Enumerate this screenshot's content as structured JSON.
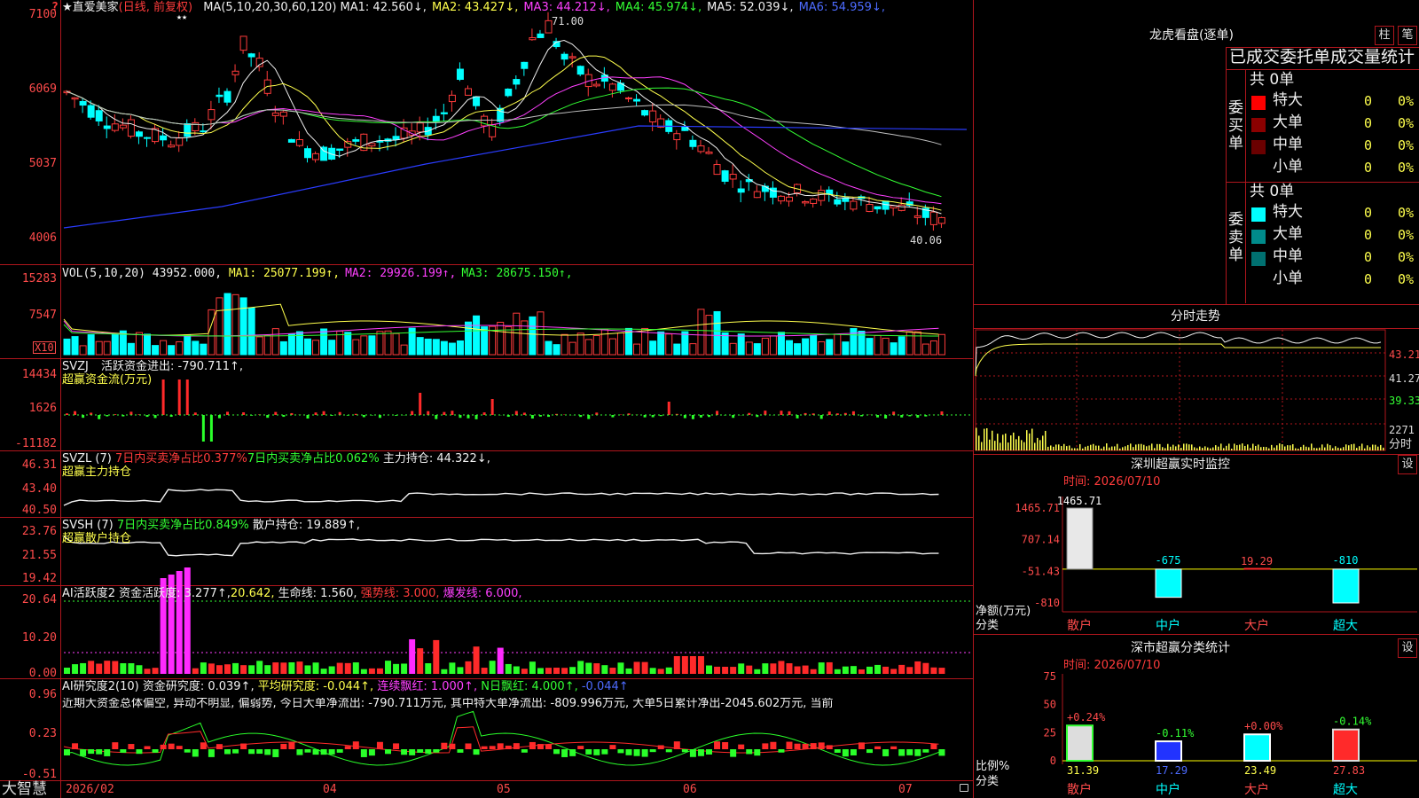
{
  "main_chart": {
    "star_name": "★直爱美家",
    "mode": "(日线, 前复权)",
    "ma_params": "MA(5,10,20,30,60,120)",
    "ma": [
      {
        "label": "MA1:",
        "value": "42.560",
        "arrow": "↓",
        "color": "#f0f0f0"
      },
      {
        "label": "MA2:",
        "value": "43.427",
        "arrow": "↓",
        "color": "#ffff4d"
      },
      {
        "label": "MA3:",
        "value": "44.212",
        "arrow": "↓",
        "color": "#ff40ff"
      },
      {
        "label": "MA4:",
        "value": "45.974",
        "arrow": "↓",
        "color": "#33ff33"
      },
      {
        "label": "MA5:",
        "value": "52.039",
        "arrow": "↓",
        "color": "#f0f0f0"
      },
      {
        "label": "MA6:",
        "value": "54.959",
        "arrow": "↓",
        "color": "#4d6bff"
      }
    ],
    "y_labels": [
      "7100",
      "6069",
      "5037",
      "4006"
    ],
    "high_marker": "71.00",
    "low_marker": "40.06",
    "badge": "?",
    "stars": "★★"
  },
  "vol": {
    "title": "VOL(5,10,20)",
    "value": "43952.000",
    "ma": [
      {
        "label": "MA1:",
        "value": "25077.199",
        "arrow": "↑",
        "color": "#ffff4d"
      },
      {
        "label": "MA2:",
        "value": "29926.199",
        "arrow": "↑",
        "color": "#ff40ff"
      },
      {
        "label": "MA3:",
        "value": "28675.150",
        "arrow": "↑",
        "color": "#33ff33"
      }
    ],
    "y_labels": [
      "15283",
      "7547"
    ],
    "unit": "X10"
  },
  "svzj": {
    "title": "SVZJ",
    "line1": "活跃资金进出: -790.711↑,",
    "line2": "超赢资金流(万元)",
    "y_labels": [
      "14434",
      "1626",
      "-11182"
    ]
  },
  "svzl": {
    "title": "SVZL (7)",
    "a": "7日内买卖净占比0.377%",
    "b": "7日内买卖净占比0.062%",
    "c": "主力持仓: 44.322↓,",
    "line2": "超赢主力持仓",
    "y_labels": [
      "46.31",
      "43.40",
      "40.50"
    ]
  },
  "svsh": {
    "title": "SVSH (7)",
    "a": "7日内买卖净占比0.849%",
    "b": "散户持仓: 19.889↑,",
    "line2": "超赢散户持仓",
    "y_labels": [
      "23.76",
      "21.55",
      "19.42"
    ]
  },
  "ai_active": {
    "title": "AI活跃度2",
    "a": "资金活跃度: 3.277↑,",
    "b": "20.642,",
    "c": "生命线: 1.560,",
    "d": "强势线: 3.000,",
    "e": "爆发线: 6.000,",
    "y_labels": [
      "20.64",
      "10.20",
      "0.00"
    ]
  },
  "ai_research": {
    "title": "AI研究度2(10)",
    "a": "资金研究度: 0.039↑,",
    "b": "平均研究度: -0.044↑,",
    "c": "连续飘红: 1.000↑,",
    "d": "N日飘红: 4.000↑,",
    "e": "-0.044↑",
    "comment": "近期大资金总体偏空, 异动不明显, 偏弱势, 今日大单净流出: -790.711万元, 其中特大单净流出: -809.996万元, 大单5日累计净出-2045.602万元, 当前",
    "y_labels": [
      "0.96",
      "0.23",
      "-0.51"
    ]
  },
  "bottom_bar": {
    "brand": "大智慧",
    "dates": [
      "2026/02",
      "04",
      "05",
      "06",
      "07"
    ]
  },
  "dragon_tiger": {
    "title": "龙虎看盘(逐单)",
    "btn_bar": "柱",
    "btn_pen": "笔",
    "subtitle": "已成交委托单成交量统计",
    "buy_label": "委买单",
    "sell_label": "委卖单",
    "buy_total": "共 0单",
    "sell_total": "共 0单",
    "buy_rows": [
      {
        "name": "特大",
        "count": "0",
        "pct": "0%",
        "color": "#ff0000"
      },
      {
        "name": "大单",
        "count": "0",
        "pct": "0%",
        "color": "#8b0000"
      },
      {
        "name": "中单",
        "count": "0",
        "pct": "0%",
        "color": "#6a0000"
      },
      {
        "name": "小单",
        "count": "0",
        "pct": "0%",
        "color": "#000000"
      }
    ],
    "sell_rows": [
      {
        "name": "特大",
        "count": "0",
        "pct": "0%",
        "color": "#00ffff"
      },
      {
        "name": "大单",
        "count": "0",
        "pct": "0%",
        "color": "#008b8b"
      },
      {
        "name": "中单",
        "count": "0",
        "pct": "0%",
        "color": "#007070"
      },
      {
        "name": "小单",
        "count": "0",
        "pct": "0%",
        "color": "#000000"
      }
    ]
  },
  "intraday": {
    "title": "分时走势",
    "y_labels": [
      "43.21",
      "41.27",
      "39.33"
    ],
    "vol_label": "2271",
    "vol_unit": "分时"
  },
  "sz_monitor": {
    "title": "深圳超赢实时监控",
    "settings": "设",
    "time": "时间: 2026/07/10",
    "y_labels": [
      "1465.71",
      "707.14",
      "-51.43",
      "-810"
    ],
    "axis_caption1": "净额(万元)",
    "axis_caption2": "分类",
    "chart_data": {
      "type": "bar",
      "categories": [
        "散户",
        "中户",
        "大户",
        "超大"
      ],
      "values": [
        1465.71,
        -675,
        19.29,
        -810
      ],
      "value_labels": [
        "1465.71",
        "-675",
        "19.29",
        "-810"
      ],
      "ylim": [
        -810,
        1465.71
      ]
    }
  },
  "sz_stats": {
    "title": "深市超赢分类统计",
    "settings": "设",
    "time": "时间: 2026/07/10",
    "y_labels": [
      "75",
      "50",
      "25",
      "0"
    ],
    "axis_caption1": "比例%",
    "axis_caption2": "分类",
    "chart_data": {
      "type": "bar",
      "categories": [
        "散户",
        "中户",
        "大户",
        "超大"
      ],
      "values": [
        31.39,
        17.29,
        23.49,
        27.83
      ],
      "changes": [
        "+0.24%",
        "-0.11%",
        "+0.00%",
        "-0.14%"
      ],
      "ylim": [
        0,
        75
      ]
    }
  }
}
